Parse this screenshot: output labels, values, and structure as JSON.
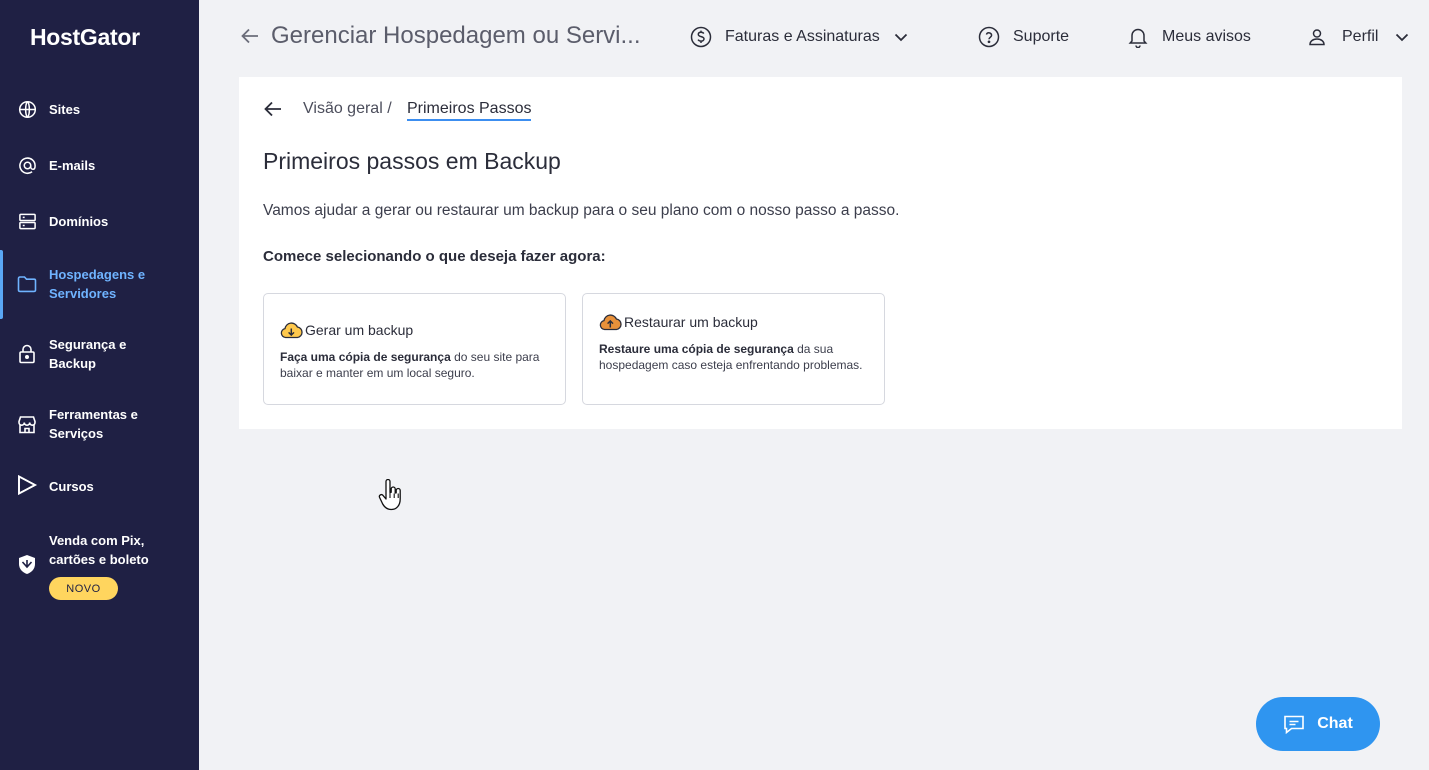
{
  "brand": "HostGator",
  "sidebar": {
    "items": [
      {
        "label": "Sites",
        "icon": "globe-icon"
      },
      {
        "label": "E-mails",
        "icon": "at-sign-icon"
      },
      {
        "label": "Domínios",
        "icon": "server-icon"
      },
      {
        "label": "Hospedagens e Servidores",
        "icon": "folder-icon",
        "active": true
      },
      {
        "label": "Segurança e Backup",
        "icon": "lock-icon"
      },
      {
        "label": "Ferramentas e Serviços",
        "icon": "store-icon"
      },
      {
        "label": "Cursos",
        "icon": "play-icon"
      },
      {
        "label": "Venda com Pix, cartões e boleto",
        "icon": "shield-bird-icon",
        "badge": "NOVO"
      }
    ]
  },
  "header": {
    "title": "Gerenciar Hospedagem ou Servi...",
    "billing": "Faturas e Assinaturas",
    "support": "Suporte",
    "notices": "Meus avisos",
    "profile": "Perfil"
  },
  "breadcrumb": {
    "home": "Visão geral /",
    "current": "Primeiros Passos"
  },
  "main": {
    "heading": "Primeiros passos em Backup",
    "description": "Vamos ajudar a gerar ou restaurar um backup para o seu plano com o nosso passo a passo.",
    "prompt": "Comece selecionando o que deseja fazer agora:",
    "options": [
      {
        "title": "Gerar um backup",
        "text_bold": "Faça uma cópia de segurança",
        "text_rest": " do seu site para baixar e manter em um local seguro.",
        "icon": "cloud-download-icon"
      },
      {
        "title": "Restaurar um backup",
        "text_bold": "Restaure uma cópia de segurança",
        "text_rest": " da sua hospedagem caso esteja enfrentando problemas.",
        "icon": "cloud-upload-icon"
      }
    ]
  },
  "chat": {
    "label": "Chat"
  },
  "colors": {
    "sidebar": "#1f2044",
    "accent": "#2f95f0",
    "active_nav": "#6fb3ff",
    "badge": "#ffd55e"
  }
}
